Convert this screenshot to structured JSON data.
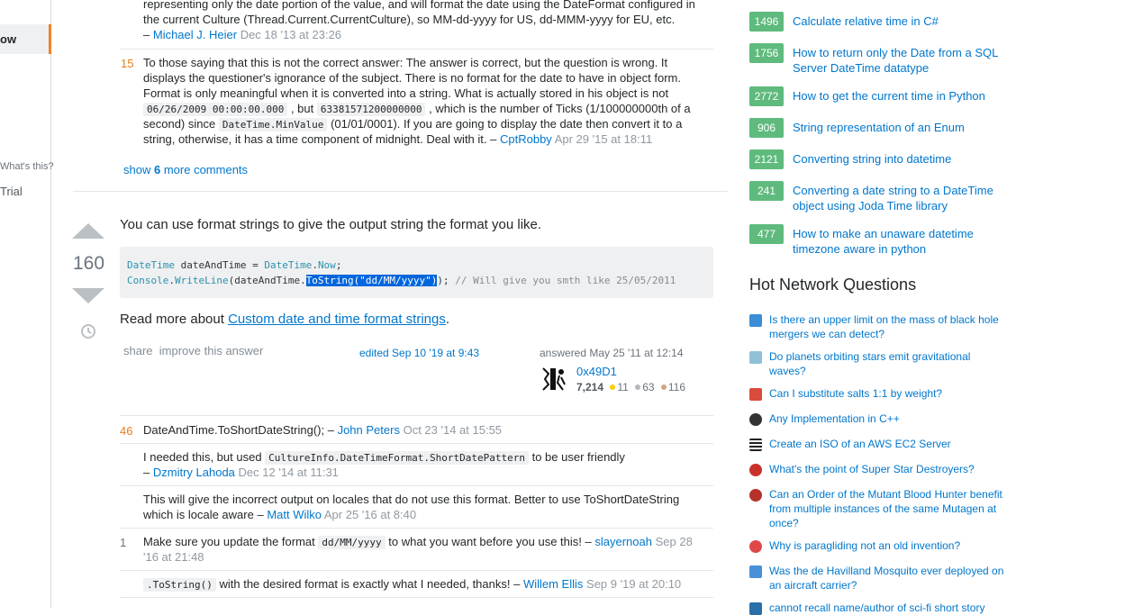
{
  "leftnav": {
    "active_item": "ow",
    "whats_this": "What's this?",
    "trial": "Trial"
  },
  "comments_top": {
    "c1_line1": "representing only the date portion of the value, and will format the date using the DateFormat configured in",
    "c1_line2": "the current Culture (Thread.Current.CurrentCulture), so MM-dd-yyyy for US, dd-MMM-yyyy for EU, etc.",
    "c1_dash": "–",
    "c1_author": "Michael J. Heier",
    "c1_date": "Dec 18 '13 at 23:26",
    "c2_score": "15",
    "c2_line1": "To those saying that this is not the correct answer: The answer is correct, but the question is wrong. It",
    "c2_line2": "displays the questioner's ignorance of the subject. There is no format for the date to have in object form.",
    "c2_line3": "Format is only meaningful when it is converted into a string. What is actually stored in his object is not",
    "c2_code1": "06/26/2009 00:00:00.000",
    "c2_mid1": ", but",
    "c2_code2": "63381571200000000",
    "c2_mid2": ", which is the number of Ticks (1/100000000th of a",
    "c2_line5a": "second) since",
    "c2_code3": "DateTime.MinValue",
    "c2_line5b": "(01/01/0001). If you are going to display the date then convert it to a",
    "c2_line6": "string, otherwise, it has a time component of midnight. Deal with it. –",
    "c2_author": "CptRobby",
    "c2_date": "Apr 29 '15 at 18:11",
    "show_more_a": "show",
    "show_more_n": "6",
    "show_more_b": "more comments"
  },
  "answer": {
    "votes": "160",
    "text": "You can use format strings to give the output string the format you like.",
    "code": {
      "l1_t1": "DateTime",
      "l1_v": " dateAndTime = ",
      "l1_t2": "DateTime",
      "l1_dot": ".",
      "l1_now": "Now",
      "l1_end": ";",
      "l2_t1": "Console",
      "l2_dot": ".",
      "l2_wl": "WriteLine",
      "l2_open": "(dateAndTime.",
      "l2_sel1": "ToString(",
      "l2_str": "\"dd/MM/yyyy\"",
      "l2_sel2": ")",
      "l2_close": ");",
      "l2_cm": " // Will give you smth like 25/05/2011"
    },
    "readmore_prefix": "Read more about",
    "readmore_link": "Custom date and time format strings",
    "readmore_suffix": ".",
    "share": "share",
    "improve": "improve this answer",
    "edited": "edited Sep 10 '19 at 9:43",
    "answered": "answered May 25 '11 at 12:14",
    "user_name": "0x49D1",
    "user_rep": "7,214",
    "gold": "11",
    "silver": "63",
    "bronze": "116",
    "gold_color": "#ffcc01",
    "silver_color": "#b4b8bc",
    "bronze_color": "#d1a684"
  },
  "comments_bottom": {
    "c1_score": "46",
    "c1_text": "DateAndTime.ToShortDateString(); –",
    "c1_author": "John Peters",
    "c1_date": "Oct 23 '14 at 15:55",
    "c2_a": "I needed this, but used",
    "c2_code": "CultureInfo.DateTimeFormat.ShortDatePattern",
    "c2_b": "to be user friendly",
    "c2_dash": "–",
    "c2_author": "Dzmitry Lahoda",
    "c2_date": "Dec 12 '14 at 11:31",
    "c3_line1": "This will give the incorrect output on locales that do not use this format. Better to use ToShortDateString",
    "c3_line2": "which is locale aware –",
    "c3_author": "Matt Wilko",
    "c3_date": "Apr 25 '16 at 8:40",
    "c4_score": "1",
    "c4_a": "Make sure you update the format",
    "c4_code": "dd/MM/yyyy",
    "c4_b": "to what you want before you use this! –",
    "c4_author": "slayernoah",
    "c4_date1": "Sep 28",
    "c4_date2": "'16 at 21:48",
    "c5_code": ".ToString()",
    "c5_text": "with the desired format is exactly what I needed, thanks! –",
    "c5_author": "Willem Ellis",
    "c5_date": "Sep 9 '19 at 20:10"
  },
  "linked": [
    {
      "count": "1496",
      "title_l1": "Calculate relative time in C#",
      "title_l2": ""
    },
    {
      "count": "1756",
      "title_l1": "How to return only the Date from a SQL",
      "title_l2": "Server DateTime datatype"
    },
    {
      "count": "2772",
      "title_l1": "How to get the current time in Python",
      "title_l2": ""
    },
    {
      "count": "906",
      "title_l1": "String representation of an Enum",
      "title_l2": ""
    },
    {
      "count": "2121",
      "title_l1": "Converting string into datetime",
      "title_l2": ""
    },
    {
      "count": "241",
      "title_l1": "Converting a date string to a DateTime",
      "title_l2": "object using Joda Time library"
    },
    {
      "count": "477",
      "title_l1": "How to make an unaware datetime",
      "title_l2": "timezone aware in python"
    }
  ],
  "hnq": {
    "title": "Hot Network Questions",
    "items": [
      {
        "l1": "Is there an upper limit on the mass of black hole",
        "l2": "mergers we can detect?",
        "l3": "",
        "color": "#3b8dd6"
      },
      {
        "l1": "Do planets orbiting stars emit gravitational",
        "l2": "waves?",
        "l3": "",
        "color": "#8fc1d6"
      },
      {
        "l1": "Can I substitute salts 1:1 by weight?",
        "l2": "",
        "l3": "",
        "color": "#d94b3c"
      },
      {
        "l1": "Any Implementation in C++",
        "l2": "",
        "l3": "",
        "color": "#333333"
      },
      {
        "l1": "Create an ISO of an AWS EC2 Server",
        "l2": "",
        "l3": "",
        "color": "#222222"
      },
      {
        "l1": "What's the point of Super Star Destroyers?",
        "l2": "",
        "l3": "",
        "color": "#c9302c"
      },
      {
        "l1": "Can an Order of the Mutant Blood Hunter benefit",
        "l2": "from multiple instances of the same Mutagen at",
        "l3": "once?",
        "color": "#b5322a"
      },
      {
        "l1": "Why is paragliding not an old invention?",
        "l2": "",
        "l3": "",
        "color": "#e04848"
      },
      {
        "l1": "Was the de Havilland Mosquito ever deployed on",
        "l2": "an aircraft carrier?",
        "l3": "",
        "color": "#4a90d9"
      },
      {
        "l1": "cannot recall name/author of sci-fi short story",
        "l2": "",
        "l3": "",
        "color": "#2a6eaa"
      }
    ]
  }
}
